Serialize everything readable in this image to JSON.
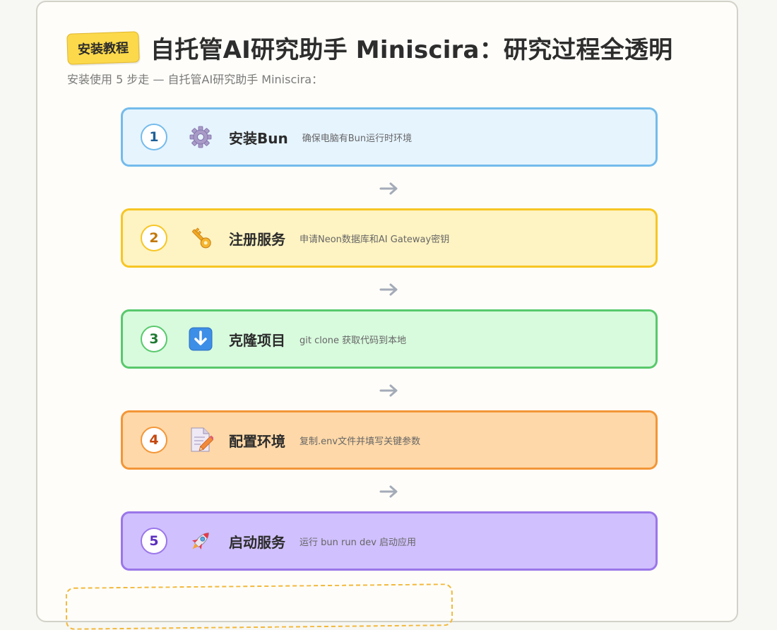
{
  "header": {
    "badge": "安装教程",
    "title": "自托管AI研究助手 Miniscira：研究过程全透明",
    "subtitle": "安装使用 5 步走 — 自托管AI研究助手 Miniscira："
  },
  "steps": [
    {
      "number": "1",
      "icon": "gear-icon",
      "title": "安装Bun",
      "desc": "确保电脑有Bun运行时环境"
    },
    {
      "number": "2",
      "icon": "key-icon",
      "title": "注册服务",
      "desc": "申请Neon数据库和AI Gateway密钥"
    },
    {
      "number": "3",
      "icon": "download-arrow-icon",
      "title": "克隆项目",
      "desc": "git clone 获取代码到本地"
    },
    {
      "number": "4",
      "icon": "document-pencil-icon",
      "title": "配置环境",
      "desc": "复制.env文件并填写关键参数"
    },
    {
      "number": "5",
      "icon": "rocket-icon",
      "title": "启动服务",
      "desc": "运行 bun run dev 启动应用"
    }
  ],
  "colors": {
    "step1": "#74bbec",
    "step2": "#f7c624",
    "step3": "#58c96c",
    "step4": "#f39637",
    "step5": "#9a76ea",
    "badge": "#fcd94a",
    "note_border": "#f2b83a"
  }
}
